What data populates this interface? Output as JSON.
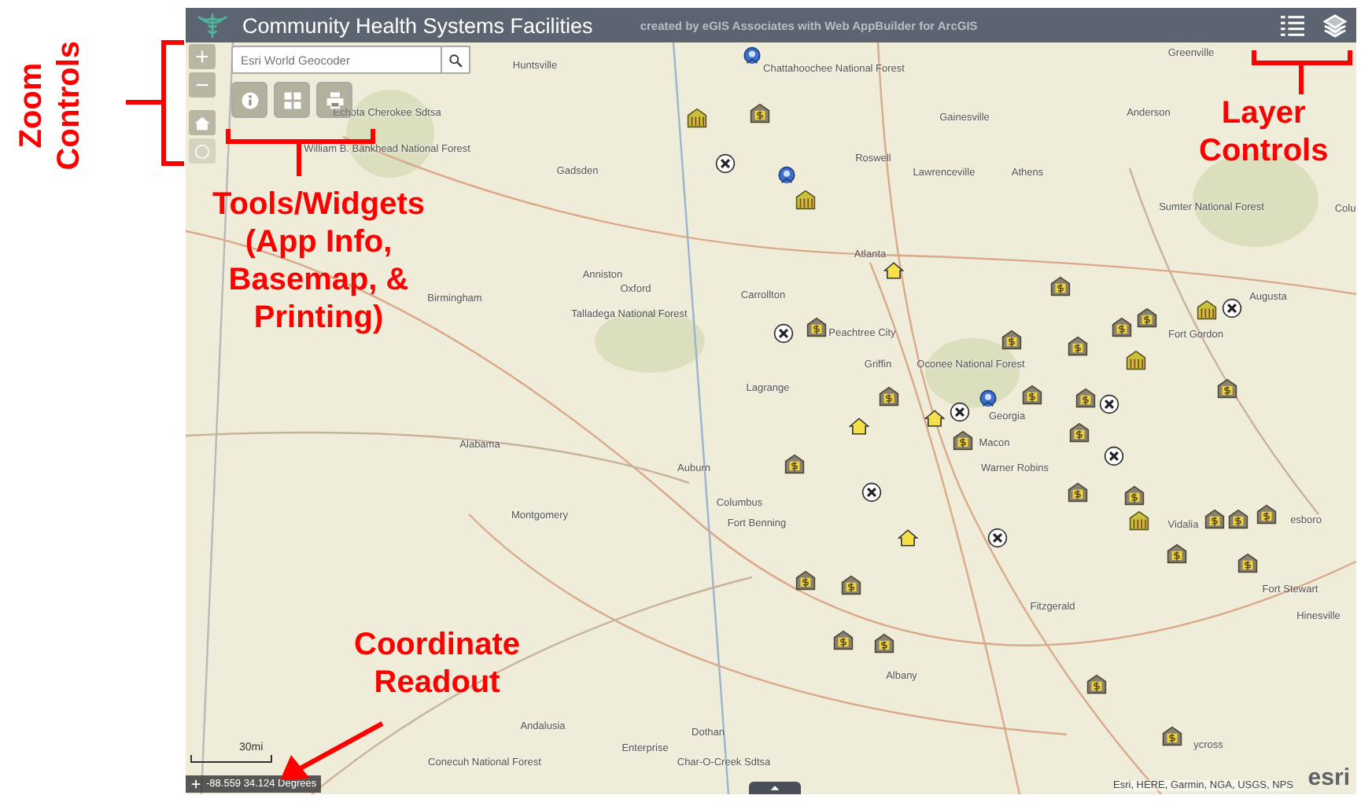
{
  "header": {
    "title": "Community Health Systems Facilities",
    "subtitle": "created by eGIS Associates with Web AppBuilder for ArcGIS"
  },
  "zoom_controls": {
    "zoom_in": "+",
    "zoom_out": "−",
    "locate_disabled": true
  },
  "search": {
    "placeholder": "Esri World Geocoder"
  },
  "map_labels": [
    "Huntsville",
    "Chattahoochee National Forest",
    "Greenville",
    "Anderson",
    "Gainesville",
    "Roswell",
    "Lawrenceville",
    "Athens",
    "Sumter National Forest",
    "Colu",
    "Gadsden",
    "Echota Cherokee Sdtsa",
    "William B. Bankhead National Forest",
    "Atlanta",
    "Anniston",
    "Oxford",
    "Birmingham",
    "Carrollton",
    "Talladega National Forest",
    "Peachtree City",
    "Griffin",
    "Augusta",
    "Fort Gordon",
    "Oconee National Forest",
    "Lagrange",
    "Georgia",
    "Macon",
    "Alabama",
    "Auburn",
    "Warner Robins",
    "Columbus",
    "Fort Benning",
    "Montgomery",
    "Vidalia",
    "esboro",
    "Fort Stewart",
    "Hinesville",
    "Fitzgerald",
    "Albany",
    "Andalusia",
    "Enterprise",
    "Dothan",
    "Conecuh National Forest",
    "Char-O-Creek Sdtsa",
    "ycross"
  ],
  "markers": [
    {
      "kind": "cluster"
    },
    {
      "kind": "bank"
    },
    {
      "kind": "clinic"
    },
    {
      "kind": "cross"
    },
    {
      "kind": "cluster"
    },
    {
      "kind": "clinic"
    },
    {
      "kind": "house"
    },
    {
      "kind": "cross"
    },
    {
      "kind": "bank"
    },
    {
      "kind": "bank"
    },
    {
      "kind": "clinic"
    },
    {
      "kind": "cross"
    },
    {
      "kind": "bank"
    },
    {
      "kind": "bank"
    },
    {
      "kind": "bank"
    },
    {
      "kind": "bank"
    },
    {
      "kind": "clinic"
    },
    {
      "kind": "bank"
    },
    {
      "kind": "bank"
    },
    {
      "kind": "bank"
    },
    {
      "kind": "house"
    },
    {
      "kind": "house"
    },
    {
      "kind": "cross"
    },
    {
      "kind": "cluster"
    },
    {
      "kind": "bank"
    },
    {
      "kind": "bank"
    },
    {
      "kind": "cross"
    },
    {
      "kind": "bank"
    },
    {
      "kind": "cross"
    },
    {
      "kind": "bank"
    },
    {
      "kind": "cross"
    },
    {
      "kind": "bank"
    },
    {
      "kind": "bank"
    },
    {
      "kind": "clinic"
    },
    {
      "kind": "bank"
    },
    {
      "kind": "bank"
    },
    {
      "kind": "bank"
    },
    {
      "kind": "house"
    },
    {
      "kind": "cross"
    },
    {
      "kind": "bank"
    },
    {
      "kind": "bank"
    },
    {
      "kind": "bank"
    },
    {
      "kind": "bank"
    },
    {
      "kind": "bank"
    },
    {
      "kind": "bank"
    },
    {
      "kind": "bank"
    },
    {
      "kind": "bank"
    }
  ],
  "scale": "30mi",
  "coordinates": "-88.559 34.124 Degrees",
  "attribution": "Esri, HERE, Garmin, NGA, USGS, NPS",
  "logo": "esri",
  "annotations": [
    {
      "text": "Zoom\nControls",
      "kind": "rotated"
    },
    {
      "text": "Tools/Widgets\n(App Info,\nBasemap, &\nPrinting)",
      "kind": "plain"
    },
    {
      "text": "Layer\nControls",
      "kind": "plain"
    },
    {
      "text": "Coordinate\nReadout",
      "kind": "plain"
    }
  ]
}
